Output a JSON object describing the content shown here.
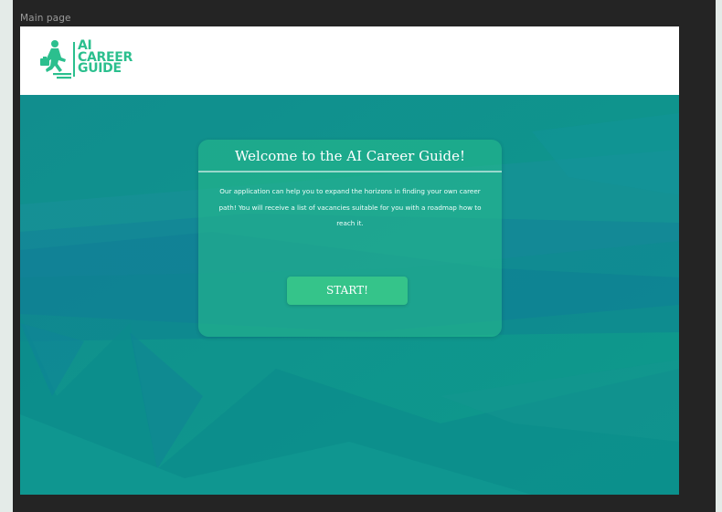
{
  "frame": {
    "label": "Main page"
  },
  "header": {
    "logo": {
      "line1": "AI",
      "line2": "CAREER",
      "line3": "GUIDE",
      "icon": "walking-person-briefcase-icon"
    }
  },
  "card": {
    "title": "Welcome to the AI Career Guide!",
    "description": "Our application can help you to expand the horizons in finding your own career path! You will receive a list of vacancies suitable for you with a roadmap how to reach it.",
    "button_label": "START!"
  },
  "colors": {
    "brand": "#2bbf8e",
    "background": "#0e8d8c",
    "button": "#35c48a",
    "frame": "#242424"
  }
}
